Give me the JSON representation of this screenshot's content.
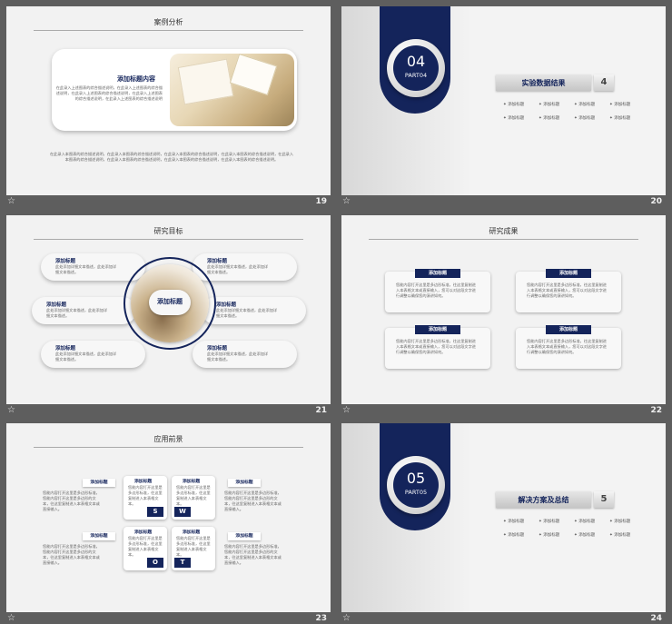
{
  "slides": {
    "s19": {
      "number": "19",
      "title": "案例分析",
      "card_title": "添加标题内容",
      "card_body": "在此录入上述图表的综合描述说明，在此录入上述图表的综合描述说明，在此录入上述图表的综合描述说明，在此录入上述图表的综合描述说明，在此录入上述图表的综合描述说明",
      "paragraph": "在此录入本图表的综合描述说明，在此录入本图表的综合描述说明，在此录入本图表的综合描述说明，在此录入本图表的综合描述说明，在此录入本图表的综合描述说明，在此录入本图表的综合描述说明，在此录入本图表的综合描述说明，在此录入本图表的综合描述说明。"
    },
    "s20": {
      "number": "20",
      "part_number": "04",
      "part_label": "PART04",
      "section_title": "实验数据结果",
      "section_number": "4",
      "items": [
        "添加标题",
        "添加标题",
        "添加标题",
        "添加标题",
        "添加标题",
        "添加标题",
        "添加标题",
        "添加标题"
      ]
    },
    "s21": {
      "number": "21",
      "title": "研究目标",
      "center_label": "添加标题",
      "pills": [
        {
          "title": "添加标题",
          "body": "此处添加详细文本描述，此处添加详细文本描述。"
        },
        {
          "title": "添加标题",
          "body": "此处添加详细文本描述，此处添加详细文本描述。"
        },
        {
          "title": "添加标题",
          "body": "此处添加详细文本描述，此处添加详细文本描述。"
        },
        {
          "title": "添加标题",
          "body": "此处添加详细文本描述，此处添加详细文本描述。"
        },
        {
          "title": "添加标题",
          "body": "此处添加详细文本描述，此处添加详细文本描述。"
        },
        {
          "title": "添加标题",
          "body": "此处添加详细文本描述，此处添加详细文本描述。"
        }
      ]
    },
    "s22": {
      "number": "22",
      "title": "研究成果",
      "boxes": [
        {
          "title": "添加标题",
          "body": "您能内容打开这里是多边形标准，往这里复制进入本表格文本或直接输入，您可以对这段文字进行调整以确保您的演讲如何。"
        },
        {
          "title": "添加标题",
          "body": "您能内容打开这里是多边形标准，往这里复制进入本表格文本或直接输入，您可以对这段文字进行调整以确保您的演讲如何。"
        },
        {
          "title": "添加标题",
          "body": "您能内容打开这里是多边形标准，往这里复制进入本表格文本或直接输入，您可以对这段文字进行调整以确保您的演讲如何。"
        },
        {
          "title": "添加标题",
          "body": "您能内容打开这里是多边形标准，往这里复制进入本表格文本或直接输入，您可以对这段文字进行调整以确保您的演讲如何。"
        }
      ]
    },
    "s23": {
      "number": "23",
      "title": "应用前景",
      "outer_tags": [
        "添加标题",
        "添加标题",
        "添加标题",
        "添加标题"
      ],
      "inner_tags": [
        "添加标题",
        "添加标题",
        "添加标题",
        "添加标题"
      ],
      "letters": [
        "S",
        "W",
        "O",
        "T"
      ],
      "box_text": "您能内容打开这里是多边形标准，往这里复制进入本表格文本。",
      "side_text": "您能内容打开这里是多边形标准，您能内容打开这里是多边形的文本，往这里复制进入本表格文本或直接输入。"
    },
    "s24": {
      "number": "24",
      "part_number": "05",
      "part_label": "PART05",
      "section_title": "解决方案及总结",
      "section_number": "5",
      "items": [
        "添加标题",
        "添加标题",
        "添加标题",
        "添加标题",
        "添加标题",
        "添加标题",
        "添加标题",
        "添加标题"
      ]
    }
  },
  "footer": {
    "star_icon": "☆"
  },
  "colors": {
    "navy": "#14245b",
    "background": "#5e5e5e",
    "slide": "#f2f2f2"
  }
}
